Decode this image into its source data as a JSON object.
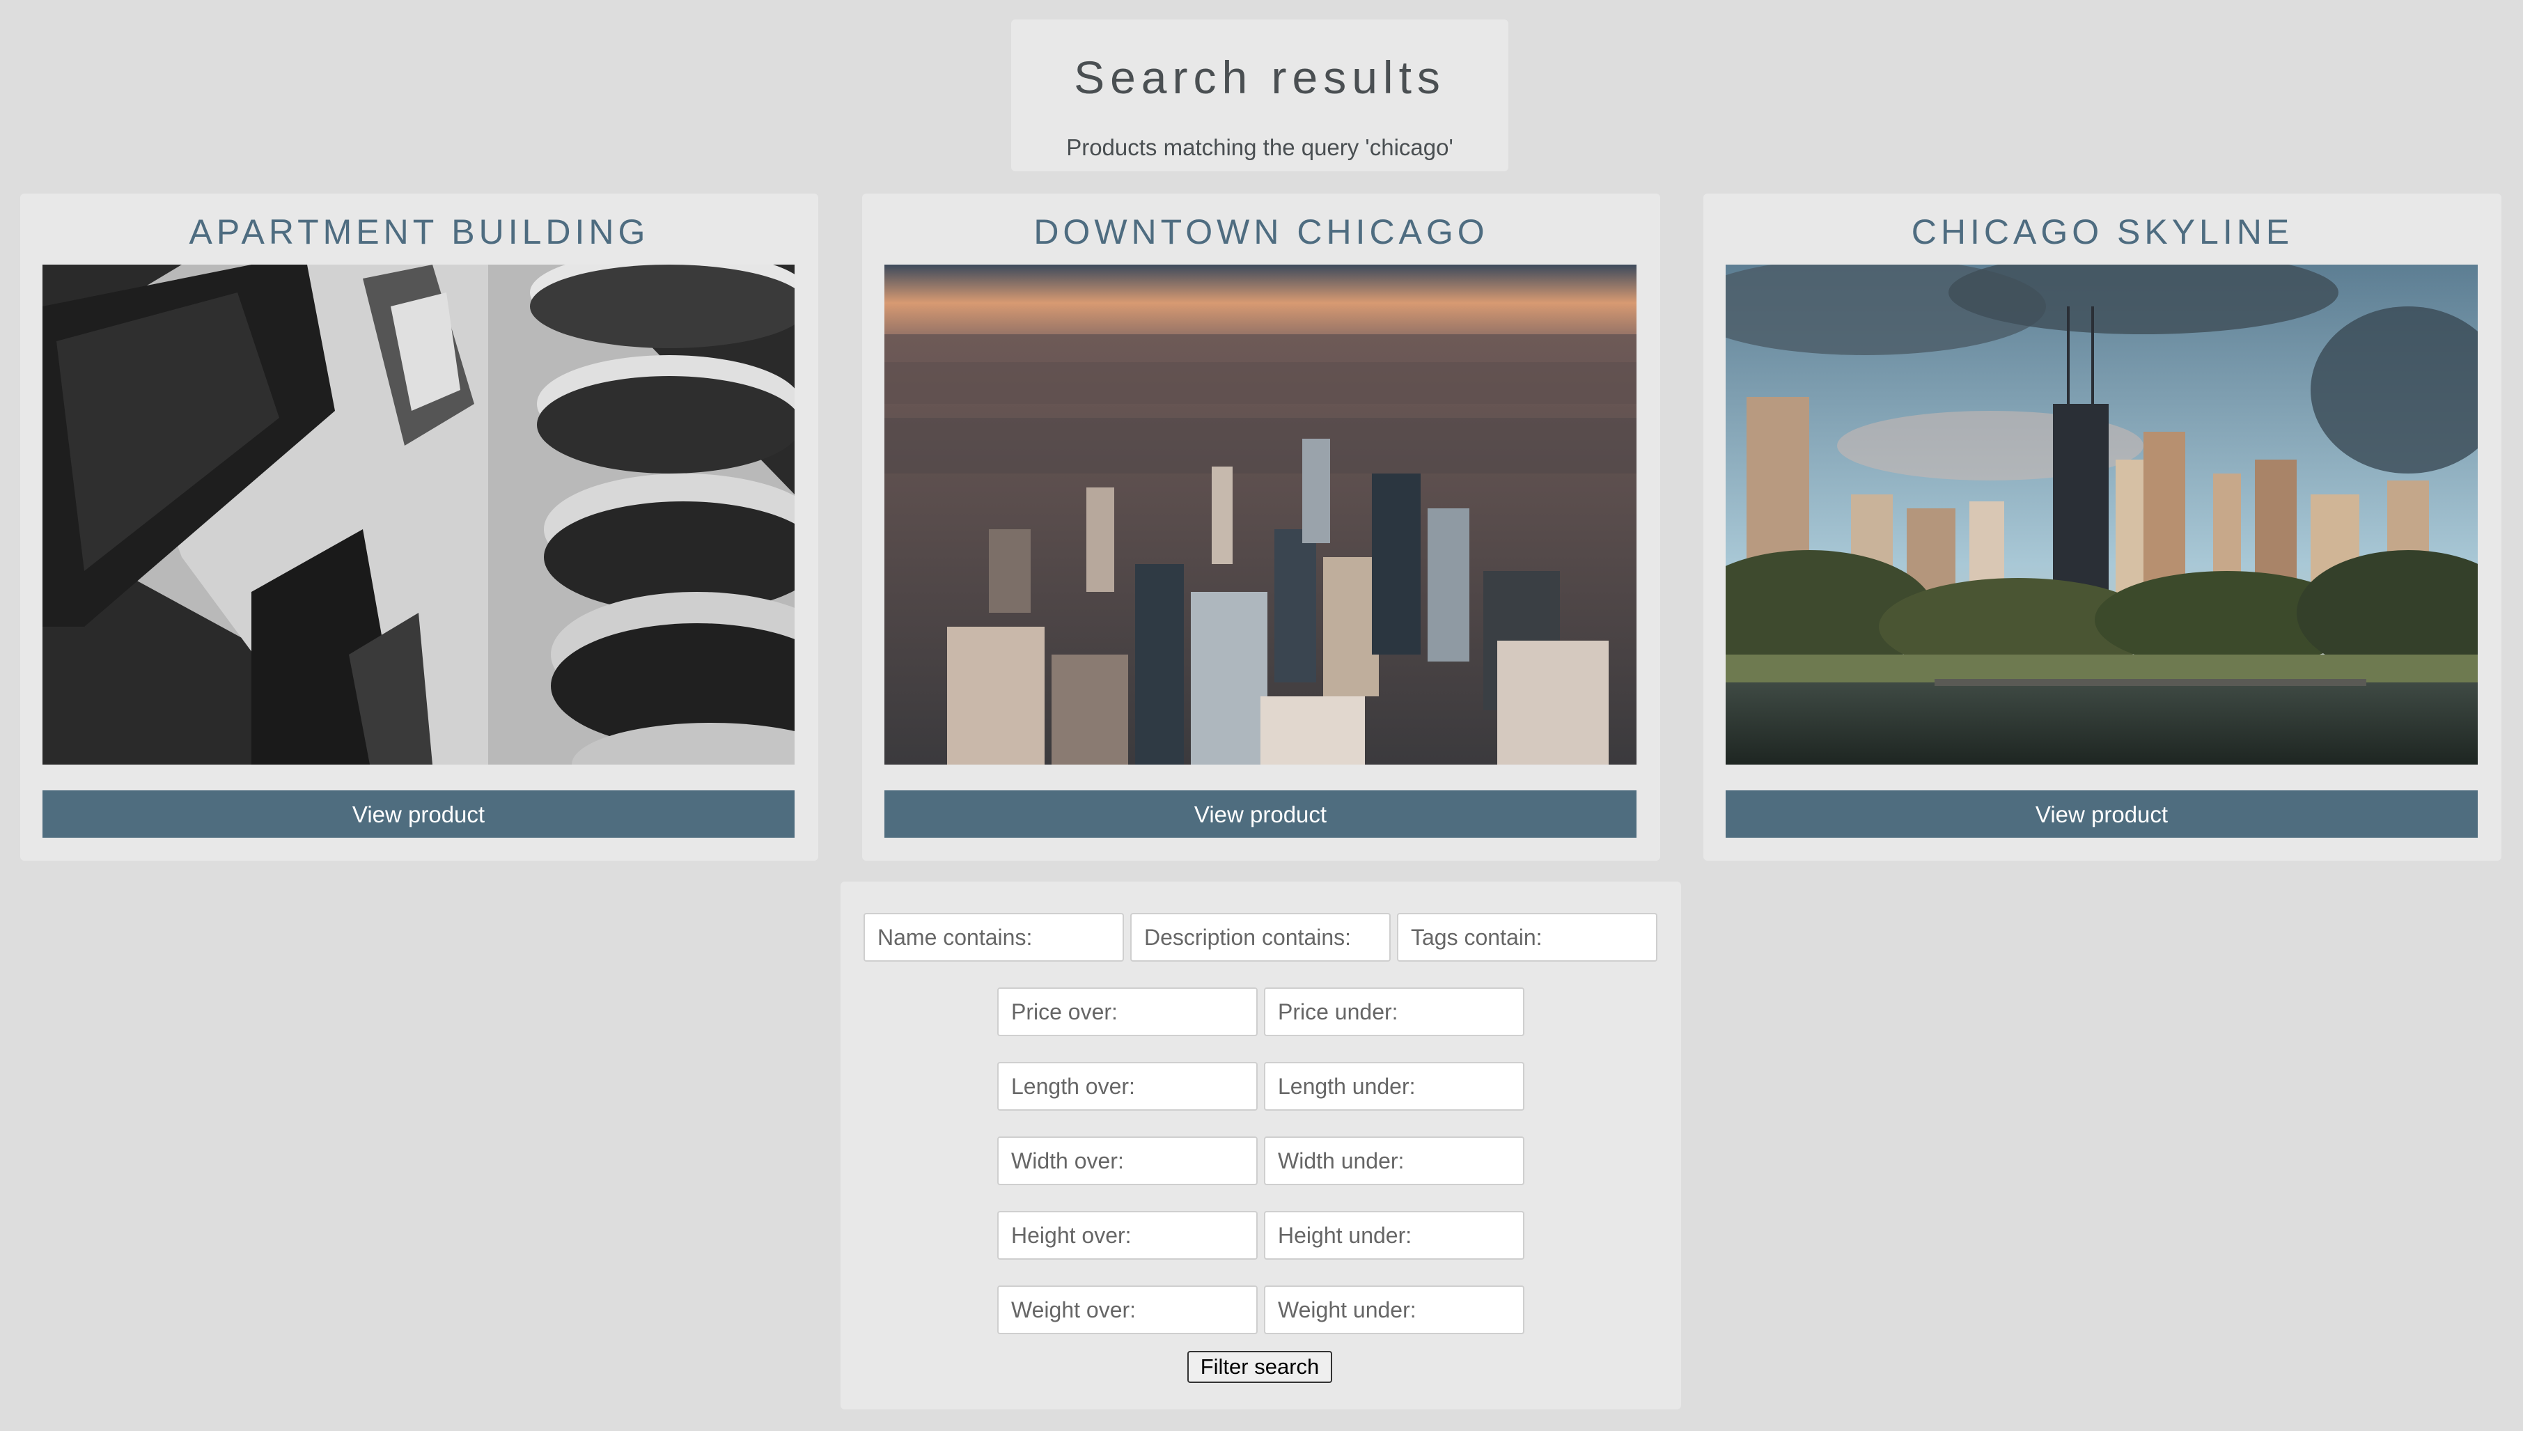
{
  "header": {
    "title": "Search results",
    "subtitle": "Products matching the query 'chicago'"
  },
  "products": [
    {
      "name": "APARTMENT BUILDING",
      "button_label": "View product",
      "image_icon": "apartment-building-photo"
    },
    {
      "name": "DOWNTOWN CHICAGO",
      "button_label": "View product",
      "image_icon": "downtown-chicago-aerial-photo"
    },
    {
      "name": "CHICAGO SKYLINE",
      "button_label": "View product",
      "image_icon": "chicago-skyline-photo"
    }
  ],
  "filters": {
    "name_contains": {
      "placeholder": "Name contains:",
      "value": ""
    },
    "description_contains": {
      "placeholder": "Description contains:",
      "value": ""
    },
    "tags_contain": {
      "placeholder": "Tags contain:",
      "value": ""
    },
    "price_over": {
      "placeholder": "Price over:",
      "value": ""
    },
    "price_under": {
      "placeholder": "Price under:",
      "value": ""
    },
    "length_over": {
      "placeholder": "Length over:",
      "value": ""
    },
    "length_under": {
      "placeholder": "Length under:",
      "value": ""
    },
    "width_over": {
      "placeholder": "Width over:",
      "value": ""
    },
    "width_under": {
      "placeholder": "Width under:",
      "value": ""
    },
    "height_over": {
      "placeholder": "Height over:",
      "value": ""
    },
    "height_under": {
      "placeholder": "Height under:",
      "value": ""
    },
    "weight_over": {
      "placeholder": "Weight over:",
      "value": ""
    },
    "weight_under": {
      "placeholder": "Weight under:",
      "value": ""
    },
    "submit_label": "Filter search"
  },
  "colors": {
    "page_background": "#dddddd",
    "panel_background": "#e8e8e8",
    "title_accent": "#4e6c80",
    "button_background": "#4f6d7f",
    "button_text": "#ffffff"
  }
}
